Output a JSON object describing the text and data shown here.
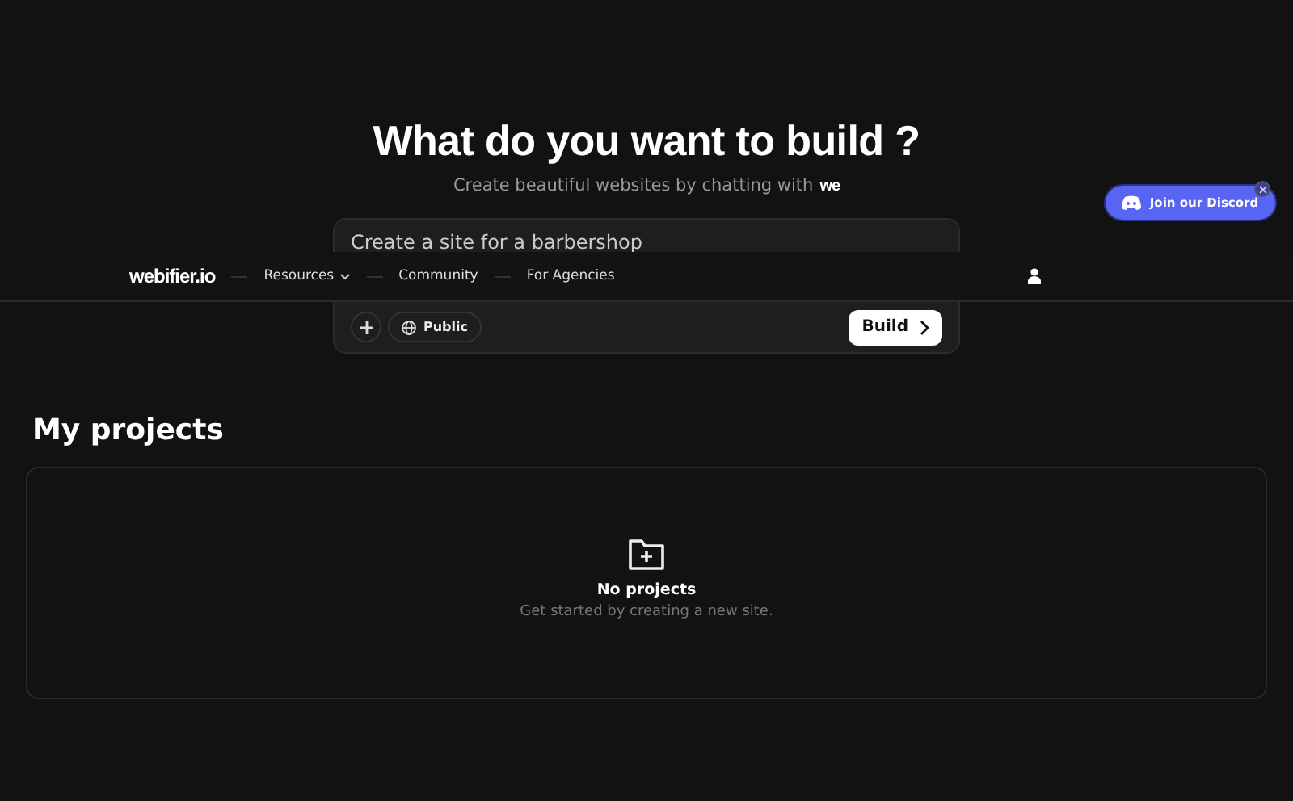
{
  "hero": {
    "title": "What do you want to build ?",
    "subtitle": "Create beautiful websites by chatting with",
    "subtitle_logo": "we"
  },
  "prompt": {
    "value": "Create a site for a barbershop",
    "visibility": "Public",
    "submit": "Build"
  },
  "nav": {
    "logo": "webifier.io",
    "items": [
      {
        "label": "Resources",
        "dropdown": true
      },
      {
        "label": "Community",
        "dropdown": false
      },
      {
        "label": "For Agencies",
        "dropdown": false
      }
    ]
  },
  "discord": {
    "label": "Join our Discord"
  },
  "projects": {
    "title": "My projects",
    "empty_title": "No projects",
    "empty_text": "Get started by creating a new site."
  }
}
